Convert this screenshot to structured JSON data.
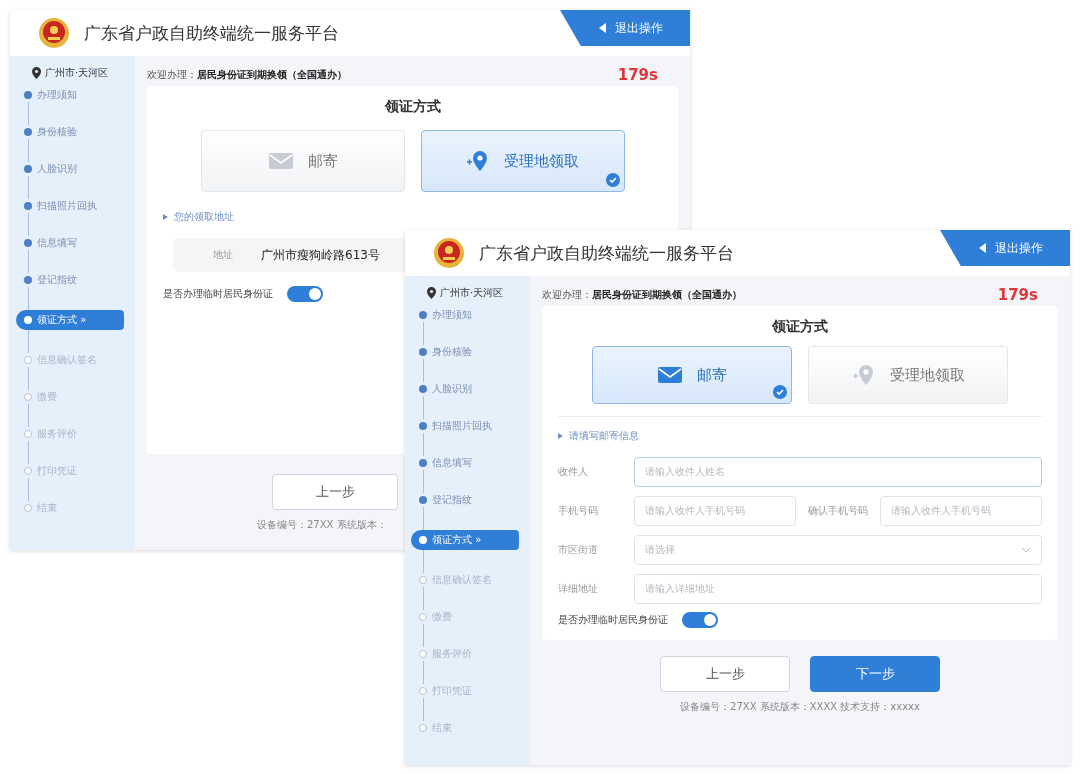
{
  "windows": [
    {
      "title": "广东省户政自助终端统一服务平台",
      "exit_button": "退出操作",
      "location": "广州市·天河区",
      "steps": [
        {
          "label": "办理须知",
          "kind": "done"
        },
        {
          "label": "身份核验",
          "kind": "done"
        },
        {
          "label": "人脸识别",
          "kind": "done"
        },
        {
          "label": "扫描照片回执",
          "kind": "done"
        },
        {
          "label": "信息填写",
          "kind": "done"
        },
        {
          "label": "登记指纹",
          "kind": "done"
        },
        {
          "label": "领证方式",
          "kind": "current",
          "arrow": "»"
        },
        {
          "label": "信息确认签名",
          "kind": "todo"
        },
        {
          "label": "缴费",
          "kind": "todo"
        },
        {
          "label": "服务评价",
          "kind": "todo"
        },
        {
          "label": "打印凭证",
          "kind": "todo"
        },
        {
          "label": "结束",
          "kind": "todo"
        }
      ],
      "welcome_label": "欢迎办理：",
      "welcome_service": "居民身份证到期换领（全国通办）",
      "countdown": "179s",
      "section_title": "领证方式",
      "methods": [
        {
          "kind": "mail",
          "label": "邮寄",
          "selected": false
        },
        {
          "kind": "pin",
          "label": "受理地领取",
          "selected": true
        }
      ],
      "subsection": "您的领取地址",
      "address": {
        "label": "地址",
        "value": "广州市瘦狗岭路613号"
      },
      "toggle": {
        "label": "是否办理临时居民身份证",
        "on": true
      },
      "buttons": [
        {
          "label": "上一步",
          "kind": "secondary"
        }
      ],
      "footer": "设备编号：27XX 系统版本："
    },
    {
      "title": "广东省户政自助终端统一服务平台",
      "exit_button": "退出操作",
      "location": "广州市·天河区",
      "steps": [
        {
          "label": "办理须知",
          "kind": "done"
        },
        {
          "label": "身份核验",
          "kind": "done"
        },
        {
          "label": "人脸识别",
          "kind": "done"
        },
        {
          "label": "扫描照片回执",
          "kind": "done"
        },
        {
          "label": "信息填写",
          "kind": "done"
        },
        {
          "label": "登记指纹",
          "kind": "done"
        },
        {
          "label": "领证方式",
          "kind": "current",
          "arrow": "»"
        },
        {
          "label": "信息确认签名",
          "kind": "todo"
        },
        {
          "label": "缴费",
          "kind": "todo"
        },
        {
          "label": "服务评价",
          "kind": "todo"
        },
        {
          "label": "打印凭证",
          "kind": "todo"
        },
        {
          "label": "结束",
          "kind": "todo"
        }
      ],
      "welcome_label": "欢迎办理：",
      "welcome_service": "居民身份证到期换领（全国通办）",
      "countdown": "179s",
      "section_title": "领证方式",
      "methods": [
        {
          "kind": "mail",
          "label": "邮寄",
          "selected": true
        },
        {
          "kind": "pin",
          "label": "受理地领取",
          "selected": false
        }
      ],
      "subsection": "请填写邮寄信息",
      "form": [
        [
          {
            "kind": "text",
            "label": "收件人",
            "placeholder": "请输入收件人姓名"
          }
        ],
        [
          {
            "kind": "text",
            "label": "手机号码",
            "placeholder": "请输入收件人手机号码"
          },
          {
            "kind": "text",
            "label": "确认手机号码",
            "placeholder": "请输入收件人手机号码"
          }
        ],
        [
          {
            "kind": "select",
            "label": "市区街道",
            "placeholder": "请选择"
          }
        ],
        [
          {
            "kind": "text",
            "label": "详细地址",
            "placeholder": "请输入详细地址"
          }
        ]
      ],
      "toggle": {
        "label": "是否办理临时居民身份证",
        "on": true
      },
      "buttons": [
        {
          "label": "上一步",
          "kind": "secondary"
        },
        {
          "label": "下一步",
          "kind": "primary"
        }
      ],
      "footer": "设备编号：27XX 系统版本：XXXX 技术支持：xxxxx"
    }
  ]
}
